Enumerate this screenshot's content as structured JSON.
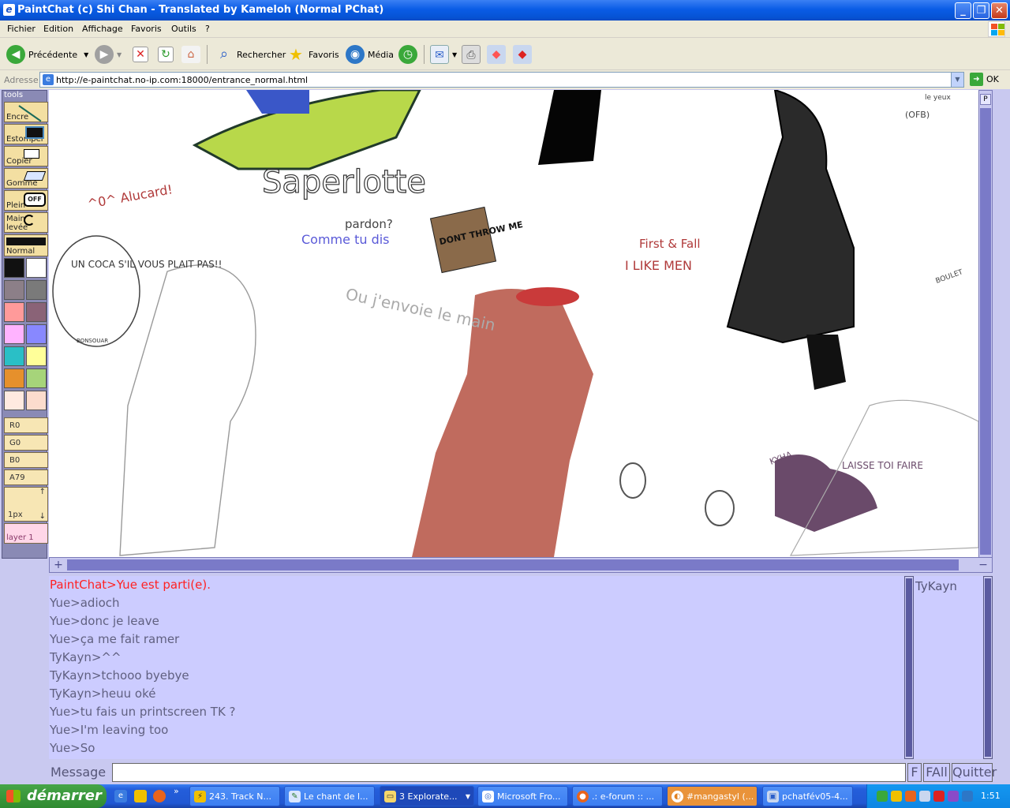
{
  "window": {
    "title": "PaintChat (c) Shi Chan - Translated by Kameloh (Normal PChat)"
  },
  "menu": [
    "Fichier",
    "Edition",
    "Affichage",
    "Favoris",
    "Outils",
    "?"
  ],
  "toolbar": {
    "back": "Précédente",
    "search": "Rechercher",
    "favorites": "Favoris",
    "media": "Média",
    "go": "OK"
  },
  "address": {
    "label": "Adresse",
    "url": "http://e-paintchat.no-ip.com:18000/entrance_normal.html"
  },
  "tools": {
    "header": "tools",
    "items": [
      "Encre",
      "Estomper",
      "Copier",
      "Gomme",
      "Plein",
      "Main levée"
    ],
    "mode": "Normal",
    "values": [
      "R0",
      "G0",
      "B0",
      "A79"
    ],
    "pen_size": "1px",
    "layer": "layer 1",
    "palette": [
      "#111111",
      "#ffffff",
      "#8c7f88",
      "#7a7a7a",
      "#ff9a9a",
      "#8a6377",
      "#ffb3ff",
      "#8888ff",
      "#2abfc6",
      "#ffff99",
      "#e6902c",
      "#a6d47a",
      "#ffeae0",
      "#fcdccd"
    ]
  },
  "canvas": {
    "texts": [
      "Saperlotte",
      "pardon?",
      "Comme tu dis",
      "Ou j'envoie le main",
      "UN COCA S'IL VOUS PLAIT PAS!!",
      "BONSOUAR",
      "^0^ Alucard!",
      "DONT THROW ME",
      "First & Fall",
      "I LIKE MEN",
      "LAISSE TOI FAIRE",
      "KYHA",
      "(OFB)",
      "le yeux",
      "BOULET"
    ]
  },
  "chat": {
    "messages": [
      {
        "text": "PaintChat>Yue est parti(e).",
        "color": "#ff2222"
      },
      {
        "text": "Yue>adioch",
        "color": "#606080"
      },
      {
        "text": "Yue>donc je leave",
        "color": "#606080"
      },
      {
        "text": "Yue>ça me fait ramer",
        "color": "#606080"
      },
      {
        "text": "TyKayn>^^",
        "color": "#606080"
      },
      {
        "text": "TyKayn>tchooo byebye",
        "color": "#606080"
      },
      {
        "text": "TyKayn>heuu oké",
        "color": "#606080"
      },
      {
        "text": "Yue>tu fais un printscreen TK ?",
        "color": "#606080"
      },
      {
        "text": "Yue>I'm leaving too",
        "color": "#606080"
      },
      {
        "text": "Yue>So",
        "color": "#606080"
      }
    ],
    "users": [
      "TyKayn"
    ],
    "message_label": "Message",
    "buttons": {
      "f": "F",
      "fall": "FAll",
      "quit": "Quitter"
    }
  },
  "taskbar": {
    "start": "démarrer",
    "tasks": [
      "243. Track N...",
      "Le chant de l...",
      "3 Explorate...",
      "Microsoft Fro...",
      ".: e-forum :: ...",
      "#mangastyl (...",
      "pchatfév05-4..."
    ],
    "clock": "1:51"
  }
}
